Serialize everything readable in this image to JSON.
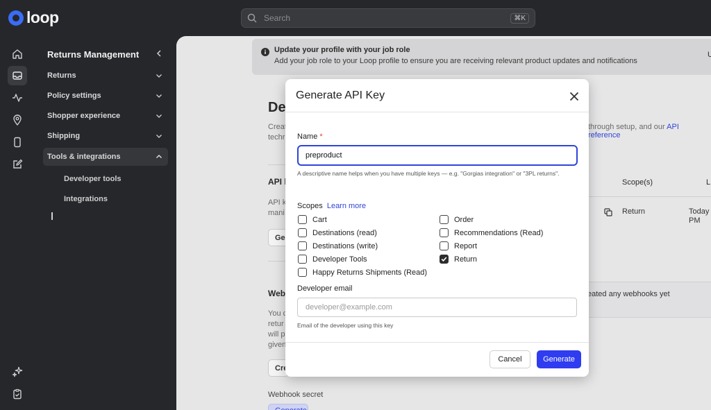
{
  "app": {
    "logo_text": "loop"
  },
  "search": {
    "placeholder": "Search",
    "shortcut": "⌘K"
  },
  "rail": {
    "icons": [
      "home-icon",
      "inbox-icon",
      "activity-icon",
      "location-pin-icon",
      "mobile-icon",
      "edit-icon",
      "sparkle-icon",
      "clipboard-check-icon"
    ]
  },
  "sidebar": {
    "title": "Returns Management",
    "items": [
      {
        "label": "Returns"
      },
      {
        "label": "Policy settings"
      },
      {
        "label": "Shopper experience"
      },
      {
        "label": "Shipping"
      },
      {
        "label": "Tools & integrations"
      }
    ],
    "subitems": [
      {
        "label": "Developer tools"
      },
      {
        "label": "Integrations"
      }
    ]
  },
  "banner": {
    "title": "Update your profile with your job role",
    "text": "Add your job role to your Loop profile to ensure you are receiving relevant product updates and notifications",
    "right": "U"
  },
  "background": {
    "heading": "De",
    "intro_line1": "Creat",
    "intro_tail": "through setup, and our ",
    "api_reference": "API reference",
    "intro_line2": "techr",
    "api_section": "API k",
    "api_desc1": "API k",
    "api_desc2": "mani",
    "gen_btn": "Gen",
    "col_scopes": "Scope(s)",
    "col_last": "L",
    "row_scope": "Return",
    "row_date1": "Today",
    "row_date2": "PM",
    "webhooks_section": "Webh",
    "webhooks_empty": "eated any webhooks yet",
    "wh_desc1": "You c",
    "wh_desc2": "retur",
    "wh_desc3": "will p",
    "wh_desc4": "given",
    "create_btn": "Cre",
    "webhook_secret": "Webhook secret",
    "generate_btn_partial": "Generate"
  },
  "modal": {
    "title": "Generate API Key",
    "name_label": "Name",
    "required_mark": "*",
    "name_value": "preproduct",
    "name_help": "A descriptive name helps when you have multiple keys — e.g. \"Gorgias integration\" or \"3PL returns\".",
    "scopes_label": "Scopes",
    "learn_more": "Learn more",
    "scopes_left": [
      {
        "label": "Cart",
        "checked": false
      },
      {
        "label": "Destinations (read)",
        "checked": false
      },
      {
        "label": "Destinations (write)",
        "checked": false
      },
      {
        "label": "Developer Tools",
        "checked": false
      },
      {
        "label": "Happy Returns Shipments (Read)",
        "checked": false
      }
    ],
    "scopes_right": [
      {
        "label": "Order",
        "checked": false
      },
      {
        "label": "Recommendations (Read)",
        "checked": false
      },
      {
        "label": "Report",
        "checked": false
      },
      {
        "label": "Return",
        "checked": true
      }
    ],
    "email_label": "Developer email",
    "email_value": "",
    "email_placeholder": "developer@example.com",
    "email_help": "Email of the developer using this key",
    "cancel_label": "Cancel",
    "generate_label": "Generate"
  }
}
